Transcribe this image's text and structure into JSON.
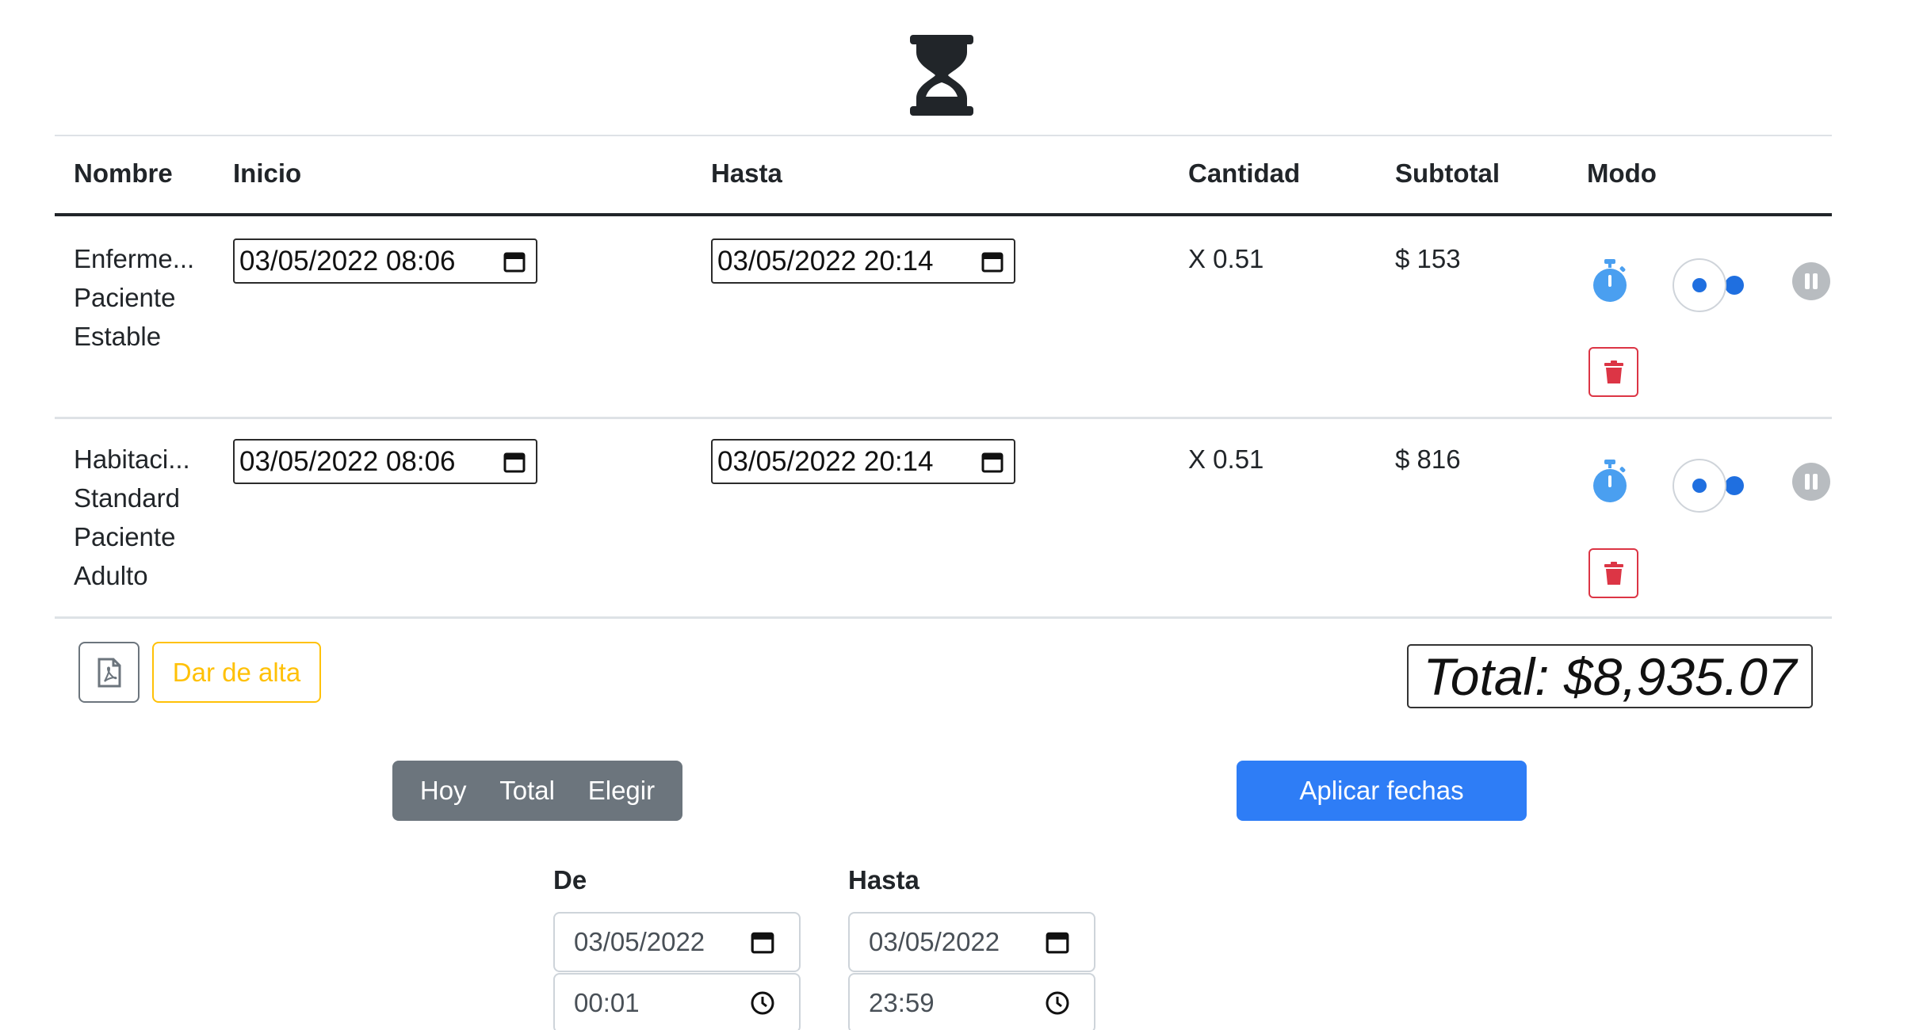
{
  "header": {
    "icon": "hourglass-icon"
  },
  "table": {
    "columns": [
      "Nombre",
      "Inicio",
      "Hasta",
      "Cantidad",
      "Subtotal",
      "Modo"
    ],
    "rows": [
      {
        "name_lines": [
          "Enferme...",
          "Paciente",
          "Estable"
        ],
        "inicio": "03/05/2022 08:06",
        "hasta": "03/05/2022 20:14",
        "cantidad": "X 0.51",
        "subtotal": "$ 153"
      },
      {
        "name_lines": [
          "Habitaci...",
          "Standard",
          "Paciente",
          "Adulto"
        ],
        "inicio": "03/05/2022 08:06",
        "hasta": "03/05/2022 20:14",
        "cantidad": "X 0.51",
        "subtotal": "$ 816"
      }
    ]
  },
  "actions": {
    "pdf_icon": "file-pdf-icon",
    "discharge_label": "Dar de alta",
    "total_label": "Total: $8,935.07"
  },
  "range": {
    "options": [
      "Hoy",
      "Total",
      "Elegir"
    ],
    "apply_label": "Aplicar fechas",
    "from_label": "De",
    "to_label": "Hasta",
    "from_date": "03/05/2022",
    "from_time": "00:01",
    "to_date": "03/05/2022",
    "to_time": "23:59"
  },
  "colors": {
    "primary": "#2e7df6",
    "danger": "#dc3545",
    "warning": "#ffc107",
    "secondary": "#6c757d",
    "timer_blue": "#4a9ff0"
  }
}
